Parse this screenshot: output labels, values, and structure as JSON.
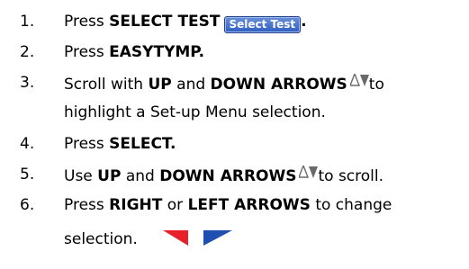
{
  "steps": [
    {
      "num": "1.",
      "prefix": "Press ",
      "bold": "SELECT TEST",
      "button_label": "Select Test",
      "suffix": "."
    },
    {
      "num": "2.",
      "prefix": "Press ",
      "bold": "EASYTYMP.",
      "suffix": ""
    },
    {
      "num": "3.",
      "prefix": "Scroll with ",
      "bold1": "UP",
      "mid": " and ",
      "bold2": "DOWN ARROWS",
      "suffix": "to",
      "line2": "highlight a Set-up Menu selection."
    },
    {
      "num": "4.",
      "prefix": "Press ",
      "bold": "SELECT.",
      "suffix": ""
    },
    {
      "num": "5.",
      "prefix": "Use ",
      "bold1": "UP",
      "mid": " and ",
      "bold2": "DOWN ARROWS",
      "suffix": "to scroll."
    },
    {
      "num": "6.",
      "prefix": "Press ",
      "bold1": "RIGHT",
      "mid": " or ",
      "bold2": "LEFT ARROWS",
      "suffix": " to change",
      "line2": "selection."
    }
  ],
  "icons": {
    "updown_color": "#6a6a6a",
    "left_flag_color": "#e8202a",
    "right_flag_color": "#1f4fb0"
  }
}
